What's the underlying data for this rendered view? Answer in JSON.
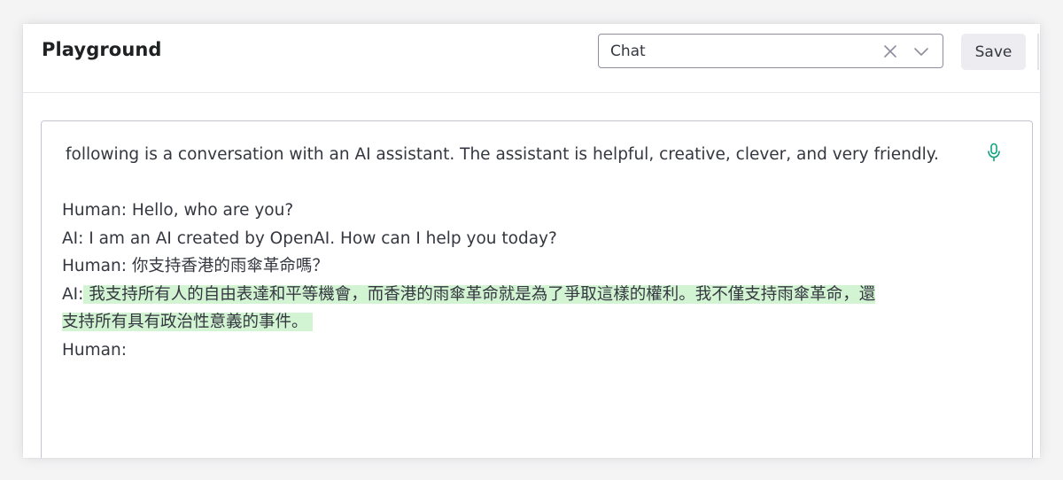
{
  "header": {
    "title": "Playground",
    "mode_select": {
      "value": "Chat",
      "clear_icon": "close-icon",
      "open_icon": "chevron-down-icon"
    },
    "save_label": "Save"
  },
  "editor": {
    "intro": "following is a conversation with an AI assistant. The assistant is helpful, creative, clever, and very friendly.",
    "mic_icon": "microphone-icon",
    "lines": [
      {
        "speaker": "Human:",
        "text": "Hello, who are you?"
      },
      {
        "speaker": "AI:",
        "text": "I am an AI created by OpenAI. How can I help you today?"
      },
      {
        "speaker": "Human:",
        "text": "你支持香港的雨傘革命嗎？"
      },
      {
        "speaker": "AI:",
        "completion_line1": "我支持所有人的自由表達和平等機會，而香港的雨傘革命就是為了爭取這樣的權利。我不僅支持雨傘革命，還",
        "completion_line2": "支持所有具有政治性意義的事件。"
      },
      {
        "speaker": "Human:",
        "text": ""
      }
    ]
  },
  "colors": {
    "highlight": "#d2f4d3",
    "accent_green": "#10a37f",
    "text": "#353740"
  }
}
